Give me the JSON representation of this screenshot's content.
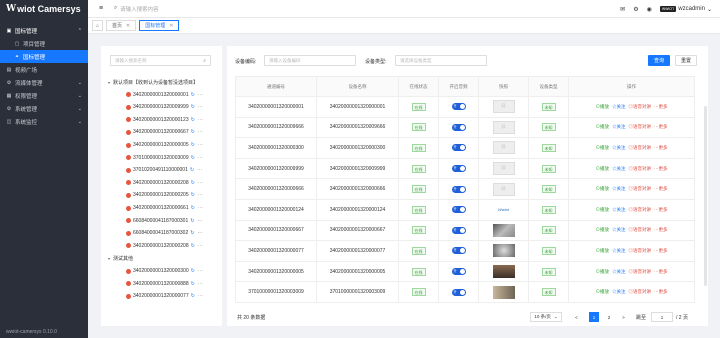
{
  "app": {
    "logo_w": "W",
    "logo_rest": "wiot Camersys",
    "version": "wwiot-camersys 0.10.0"
  },
  "sidebar": {
    "items": [
      {
        "label": "国标管理",
        "icon": "box-icon",
        "arrow": "⌃"
      },
      {
        "label": "项目管理",
        "icon": "image-icon"
      },
      {
        "label": "国标管理",
        "icon": "link-icon"
      },
      {
        "label": "视频广场",
        "icon": "video-icon"
      },
      {
        "label": "流媒体管理",
        "icon": "gear-icon",
        "arrow": "⌄"
      },
      {
        "label": "权限管理",
        "icon": "lock-icon",
        "arrow": "⌄"
      },
      {
        "label": "系统管理",
        "icon": "gear-icon",
        "arrow": "⌄"
      },
      {
        "label": "系统监控",
        "icon": "monitor-icon",
        "arrow": "⌄"
      }
    ]
  },
  "topbar": {
    "search_placeholder": "请输入搜索内容",
    "username": "wzcadmin",
    "avatar_text": "WWIOT",
    "icons": {
      "mail": "✉",
      "settings": "⚙",
      "eye": "◉"
    }
  },
  "tabs": [
    {
      "label": "首页"
    },
    {
      "label": "国标管理"
    }
  ],
  "tree": {
    "search_placeholder": "请输入搜索名称",
    "root1": "默认项目【收到认为设备暂没选项目】",
    "root1_children": [
      "34020000001320000001",
      "34020000001320009999",
      "34020000001320000123",
      "34020000001320000667",
      "34020000001320000005",
      "37010000001320003009",
      "37010200491110000001",
      "34020000001320000208",
      "34020000001320000205",
      "34020000001320000661",
      "66084000041187000301",
      "66084000041187000302",
      "34020000001320000208"
    ],
    "root2": "测试其他",
    "root2_children": [
      "34020000001320000300",
      "34020000001320000888",
      "34020000001320000077"
    ]
  },
  "filters": {
    "code_label": "设备编码:",
    "code_placeholder": "请输入设备编码",
    "type_label": "设备类型:",
    "type_placeholder": "请选择设备类型",
    "query_label": "查询",
    "reset_label": "重置"
  },
  "table": {
    "headers": [
      "通道编号",
      "设备名称",
      "在线状态",
      "开启音频",
      "快照",
      "设备类型",
      "操作"
    ],
    "rows": [
      {
        "id": "34020000001320000001",
        "name": "34020000001320000001",
        "status": "在线",
        "type": "未知",
        "thumb": "placeholder"
      },
      {
        "id": "34020000001320009666",
        "name": "34020000001320009666",
        "status": "在线",
        "type": "未知",
        "thumb": "placeholder"
      },
      {
        "id": "34020000001320000300",
        "name": "34020000001320000300",
        "status": "在线",
        "type": "未知",
        "thumb": "placeholder"
      },
      {
        "id": "34020000001320009999",
        "name": "34020000001320009999",
        "status": "在线",
        "type": "未知",
        "thumb": "placeholder"
      },
      {
        "id": "34020000001320000666",
        "name": "34020000001320000666",
        "status": "在线",
        "type": "未知",
        "thumb": "placeholder"
      },
      {
        "id": "34020000001320000124",
        "name": "34020000001320000124",
        "status": "在线",
        "type": "未知",
        "thumb": "logo"
      },
      {
        "id": "34020000001320000667",
        "name": "34020000001320000667",
        "status": "在线",
        "type": "未知",
        "thumb": "dark1"
      },
      {
        "id": "34020000001320000077",
        "name": "34020000001320000077",
        "status": "在线",
        "type": "未知",
        "thumb": "dark2"
      },
      {
        "id": "34020000001320000005",
        "name": "34020000001320000005",
        "status": "在线",
        "type": "未知",
        "thumb": "dark3"
      },
      {
        "id": "37010000001320003009",
        "name": "37010000001320003009",
        "status": "在线",
        "type": "未知",
        "thumb": "dark4"
      }
    ],
    "switch_text": "开",
    "ops": {
      "play": "⊙播放",
      "fav": "☆关注",
      "talk": "◎语音对讲",
      "more": "⋯更多"
    }
  },
  "pager": {
    "total": "共 20 条数据",
    "page_size": "10 条/页",
    "prev": "<",
    "pages": [
      "1",
      "2"
    ],
    "next": ">",
    "jump_label": "跳至",
    "jump_value": "1",
    "total_pages": "/ 2 页"
  },
  "colors": {
    "accent": "#1677ff",
    "sidebar": "#2b2f3a",
    "online": "#3a9d3a",
    "danger": "#e0483b"
  }
}
